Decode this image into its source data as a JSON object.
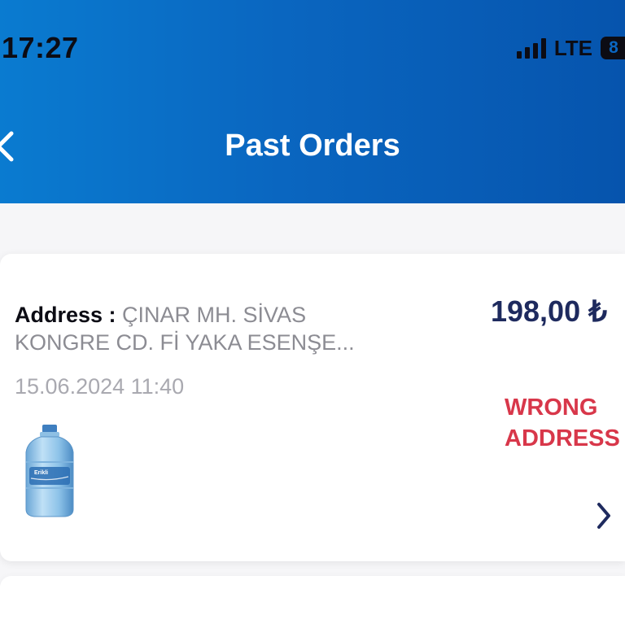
{
  "status_bar": {
    "time": "17:27",
    "network": "LTE",
    "battery": "8"
  },
  "header": {
    "title": "Past Orders"
  },
  "orders": [
    {
      "address_label": "Address : ",
      "address_line1": "ÇINAR MH.  SİVAS",
      "address_line2": "KONGRE CD. Fİ YAKA ESENŞE...",
      "date": "15.06.2024 11:40",
      "price": "198,00 ₺",
      "status_line1": "WRONG",
      "status_line2": "ADDRESS",
      "product_label": "Erikli"
    }
  ],
  "colors": {
    "header_start": "#0a7bd0",
    "header_end": "#0654ad",
    "price": "#1e2a5e",
    "status": "#d8374a",
    "muted_text": "#8c8c93"
  }
}
